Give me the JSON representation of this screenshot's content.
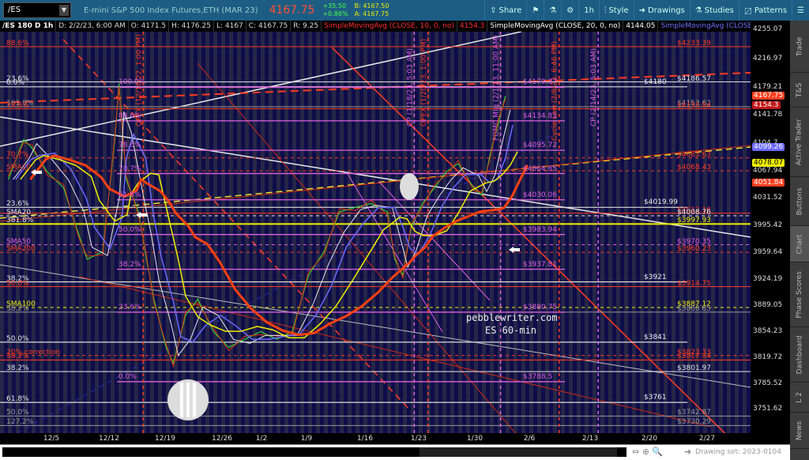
{
  "toolbar": {
    "symbol": "/ES",
    "description": "E-mini S&P 500 Index Futures,ETH (MAR 23)",
    "last": "4167.75",
    "change": "+35.50",
    "change_pct": "+0.86%",
    "bid": "B: 4167.50",
    "ask": "A: 4167.75",
    "share": "Share",
    "interval": "1h",
    "style": "Style",
    "drawings": "Drawings",
    "studies": "Studies",
    "patterns": "Patterns"
  },
  "infobar": {
    "symbol": "/ES 180 D 1h",
    "date": "D: 2/2/23, 6:00 AM",
    "open": "O: 4171.5",
    "high": "H: 4176.25",
    "low": "L: 4167",
    "close": "C: 4167.75",
    "range": "R: 9.25",
    "sma10": "SimpleMovingAvg (CLOSE, 10, 0, no)",
    "sma10_val": "4154.3",
    "sma20": "SimpleMovingAvg (CLOSE, 20, 0, no)",
    "sma20_val": "4144.05",
    "sma50": "SimpleMovingAvg (CLOSE,..."
  },
  "colors": {
    "accent": "#1d5d84",
    "red": "#ff3b1f",
    "purple": "#e060e0",
    "yellow": "#f0f000",
    "white": "#e8e8e8",
    "blue": "#6a6aff"
  },
  "price_axis": {
    "ticks": [
      "4255.07",
      "4216.97",
      "4179.21",
      "4141.78",
      "4104.7",
      "4067.94",
      "4031.52",
      "3995.42",
      "3959.64",
      "3924.19",
      "3889.05",
      "3854.23",
      "3819.72",
      "3785.52",
      "3751.62"
    ],
    "tags": [
      {
        "text": "4167.75",
        "p": 4167.75,
        "bg": "#ff4020"
      },
      {
        "text": "4154.3",
        "p": 4154.3,
        "bg": "#c01818"
      },
      {
        "text": "4099.26",
        "p": 4099.26,
        "bg": "#6a6aff"
      },
      {
        "text": "4078.07",
        "p": 4078.07,
        "bg": "#f0f000",
        "fg": "#000"
      },
      {
        "text": "4051.84",
        "p": 4051.84,
        "bg": "#ff4020"
      }
    ]
  },
  "dates": [
    "12/5",
    "12/12",
    "12/19",
    "12/26",
    "1/2",
    "1/9",
    "1/16",
    "1/23",
    "1/30",
    "2/6",
    "2/13",
    "2/20",
    "2/27"
  ],
  "side_tabs": [
    "Trade",
    "T&S",
    "Active Trader",
    "Buttons",
    "Chart",
    "Phase Scores",
    "Dashboard",
    "L 2",
    "News"
  ],
  "drawing_set": "Drawing set: 2023-0104",
  "watermark": [
    "pebblewriter.com",
    "ES 60-min"
  ],
  "events": [
    {
      "label": "OPEX (12/16/22, 1:00 PM)",
      "day": 11.3,
      "color": "#ff3b1f"
    },
    {
      "label": "CP (1/18/23, 5:03 AM)",
      "day": 44.6,
      "color": "#e060e0"
    },
    {
      "label": "OPEX (1/20/23, 1:00 PM)",
      "day": 46.3,
      "color": "#ff3b1f"
    },
    {
      "label": "FOMC Mtg (2/1/23, 11:00 AM)",
      "day": 55.2,
      "color": "#e060e0"
    },
    {
      "label": "Cycle Low (2/8/23, 6:46 PM)",
      "day": 62.4,
      "color": "#ff3b1f"
    },
    {
      "label": "CP (2/14/23, 5:03 AM)",
      "day": 67.2,
      "color": "#e060e0"
    }
  ],
  "left_labels": [
    {
      "t": "88.6%",
      "p": 4233.39,
      "c": "#ff3b1f"
    },
    {
      "t": "23.6%",
      "p": 4186.57,
      "c": "#e8e8e8"
    },
    {
      "t": "0.0%",
      "p": 4181,
      "c": "#e8e8e8"
    },
    {
      "t": "161.8%",
      "p": 4153.62,
      "c": "#999"
    },
    {
      "t": "78.6%",
      "p": 4150.84,
      "c": "#ff3b1f"
    },
    {
      "t": "70.7%",
      "p": 4085.63,
      "c": "#ff3b1f"
    },
    {
      "t": "SMA10",
      "p": 4068.43,
      "c": "#ff3b1f"
    },
    {
      "t": "23.6%",
      "p": 4019.99,
      "c": "#e8e8e8"
    },
    {
      "t": "SMA20",
      "p": 4008.76,
      "c": "#e8e8e8"
    },
    {
      "t": "381.8%",
      "p": 3997.93,
      "c": "#e8e8e8"
    },
    {
      "t": "SMA50",
      "p": 3970.35,
      "c": "#e060e0"
    },
    {
      "t": "SMA200",
      "p": 3960.23,
      "c": "#ff3b1f"
    },
    {
      "t": "38.2%",
      "p": 3921,
      "c": "#e8e8e8"
    },
    {
      "t": "50.0%",
      "p": 3914.75,
      "c": "#ff3b1f"
    },
    {
      "t": "SMA100",
      "p": 3887.12,
      "c": "#f0f000"
    },
    {
      "t": "38.2%",
      "p": 3880.85,
      "c": "#999"
    },
    {
      "t": "50.0%",
      "p": 3841,
      "c": "#e8e8e8"
    },
    {
      "t": "20% correction",
      "p": 3823.33,
      "c": "#ff3b1f"
    },
    {
      "t": "38.2%",
      "p": 3817.34,
      "c": "#ff3b1f"
    },
    {
      "t": "38.2%",
      "p": 3801.97,
      "c": "#e8e8e8"
    },
    {
      "t": "61.8%",
      "p": 3761,
      "c": "#e8e8e8"
    },
    {
      "t": "50.0%",
      "p": 3742.87,
      "c": "#999"
    },
    {
      "t": "127.2%",
      "p": 3730.29,
      "c": "#999"
    }
  ],
  "fib": [
    {
      "pct": "100.0%",
      "val": "$4179.37",
      "p": 4179.37
    },
    {
      "pct": "88.6%",
      "val": "$4134.81",
      "p": 4134.81
    },
    {
      "pct": "78.6%",
      "val": "$4095.72",
      "p": 4095.72
    },
    {
      "pct": "70.7%",
      "val": "$4064.85",
      "p": 4064.85
    },
    {
      "pct": "61.8%",
      "val": "$4030.06",
      "p": 4030.06
    },
    {
      "pct": "50.0%",
      "val": "$3983.94",
      "p": 3983.94
    },
    {
      "pct": "38.2%",
      "val": "$3937.81",
      "p": 3937.81
    },
    {
      "pct": "23.6%",
      "val": "$3880.75",
      "p": 3880.75
    },
    {
      "pct": "0.0%",
      "val": "$3788.5",
      "p": 3788.5
    }
  ],
  "mid_levels": [
    {
      "t": "$4180",
      "p": 4180
    },
    {
      "t": "$4019.99",
      "p": 4019.99
    },
    {
      "t": "$3921",
      "p": 3921
    },
    {
      "t": "$3841",
      "p": 3841
    },
    {
      "t": "$3761",
      "p": 3761
    }
  ],
  "right_levels": [
    {
      "t": "$4233.39",
      "p": 4233.39,
      "c": "#ff3b1f"
    },
    {
      "t": "$4186.57",
      "p": 4186.57,
      "c": "#e8e8e8"
    },
    {
      "t": "$4153.62",
      "p": 4153.62,
      "c": "#999"
    },
    {
      "t": "$4150.84",
      "p": 4150.84,
      "c": "#ff3b1f"
    },
    {
      "t": "$4085.63",
      "p": 4085.63,
      "c": "#ff3b1f",
      "d": 1
    },
    {
      "t": "$4068.43",
      "p": 4068.43,
      "c": "#ff3b1f",
      "d": 1
    },
    {
      "t": "$4012.16",
      "p": 4012.16,
      "c": "#ff3b1f"
    },
    {
      "t": "$4008.76",
      "p": 4008.76,
      "c": "#e8e8e8",
      "d": 1
    },
    {
      "t": "$3997.93",
      "p": 3997.93,
      "c": "#f0f000"
    },
    {
      "t": "$3970.35",
      "p": 3970.35,
      "c": "#e060e0",
      "d": 1
    },
    {
      "t": "$3960.23",
      "p": 3960.23,
      "c": "#ff3b1f",
      "d": 1
    },
    {
      "t": "$3914.75",
      "p": 3914.75,
      "c": "#ff3b1f"
    },
    {
      "t": "$3887.12",
      "p": 3887.12,
      "c": "#f0f000",
      "d": 1
    },
    {
      "t": "$3880.85",
      "p": 3880.85,
      "c": "#999"
    },
    {
      "t": "$3823.33",
      "p": 3823.33,
      "c": "#ff3b1f",
      "d": 1
    },
    {
      "t": "$3817.34",
      "p": 3817.34,
      "c": "#ff3b1f"
    },
    {
      "t": "$3801.97",
      "p": 3801.97,
      "c": "#e8e8e8"
    },
    {
      "t": "$3742.87",
      "p": 3742.87,
      "c": "#999"
    },
    {
      "t": "$3730.29",
      "p": 3730.29,
      "c": "#999"
    }
  ],
  "price_path": [
    [
      -5.3,
      4057
    ],
    [
      -3.4,
      4110
    ],
    [
      -2.4,
      4099
    ],
    [
      -0.5,
      4067
    ],
    [
      1.5,
      4046
    ],
    [
      3.4,
      3983
    ],
    [
      4.4,
      3951
    ],
    [
      6.3,
      3961
    ],
    [
      7.8,
      4110
    ],
    [
      8.3,
      4184
    ],
    [
      9.2,
      4057
    ],
    [
      10.7,
      4014
    ],
    [
      11.7,
      3951
    ],
    [
      12.6,
      3898
    ],
    [
      14.1,
      3834
    ],
    [
      15,
      3813
    ],
    [
      16.5,
      3877
    ],
    [
      18,
      3898
    ],
    [
      19.9,
      3855
    ],
    [
      21.8,
      3834
    ],
    [
      23.8,
      3845
    ],
    [
      25.7,
      3855
    ],
    [
      27.7,
      3845
    ],
    [
      29.6,
      3855
    ],
    [
      31.6,
      3930
    ],
    [
      33.5,
      3961
    ],
    [
      35.4,
      4014
    ],
    [
      37.4,
      4020
    ],
    [
      39.3,
      4025
    ],
    [
      41.3,
      4014
    ],
    [
      42.2,
      3951
    ],
    [
      43.2,
      3930
    ],
    [
      44.2,
      3993
    ],
    [
      45.6,
      4025
    ],
    [
      47.1,
      4046
    ],
    [
      48.5,
      4067
    ],
    [
      50,
      4078
    ],
    [
      51.9,
      4046
    ],
    [
      52.9,
      4036
    ],
    [
      53.9,
      4089
    ],
    [
      54.9,
      4131
    ],
    [
      55.8,
      4168
    ]
  ]
}
